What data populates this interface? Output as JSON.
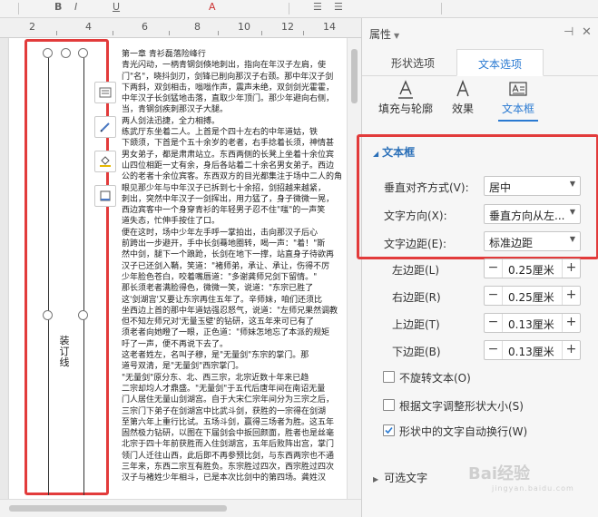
{
  "ruler": {
    "numbers": [
      "2",
      "4",
      "6",
      "8",
      "10",
      "12",
      "14"
    ]
  },
  "document": {
    "gutter_label": "装订线",
    "lines": [
      "第一章  青衫磊落险峰行",
      "  青光闪动，一柄青钢剑倏地刺出，指向在年汉子左肩，使",
      "门\"名\"，晓抖剑刃，剑锋已削向那汉子右颈。那中年汉子剑",
      "下两斜，双剑相击，嗡嗡作声，震声未绝，双剑剑光霍霍，",
      "中年汉子长剑猛地击落，直取少年顶门。那少年避向右侧，",
      "当，青钢剑疾刺那汉子大腿。",
      "  两人剑法迅捷，全力相搏。",
      "  练武厅东坐着二人。上首是个四十左右的中年道姑，铁",
      "下颌须，下首是个五十余岁的老者，右手捻着长须，神情甚",
      "男女弟子，都是肃肃站立。东西两侧的长凳上坐着十余位宾",
      "山四位相距一丈有余，身后各站着二十余名男女弟子。西边",
      "公的老者十余位宾客。东西双方的目光都集注于场中二人的角",
      "  眼见那少年与中年汉子已拆到七十余招，剑招越来越紧，",
      "刺出，突然中年汉子一剑挥出，用力猛了，身子微微一晃，",
      "西边宾客中一个身穿青衫的年轻男子忍不住\"嗤\"的一声笑",
      "道失态，忙伸手按住了口。",
      "  便在这时，场中少年左手呼一掌拍出，击向那汉子后心",
      "前跨出一步避开，手中长剑蓦地圈转，喝一声：\"着！\"斯",
      "然中剑，腿下一个踉跄，长剑在地下一撑，站直身子待欲再",
      "汉子已还剑入鞘，笑道：\"褚师弟，承让、承让，伤得不厉",
      "少年脸色苍白，咬着嘴唇道：\"多谢龚师兄剑下留情。\"",
      "  那长须老者满脸得色，微微一笑，说道：\"东宗已胜了",
      "这'剑湖宫'又要让东宗再住五年了。辛师妹，咱们还须比",
      "坐西边上首的那中年道姑强忍怒气，说道：\"左师兄果然调教",
      "但不知左师兄对'无量玉壁'的钻研，这五年来可已有了",
      "须老者向她瞪了一眼，正色道：\"师妹怎地忘了本派的规矩",
      "吁了一声，便不再说下去了。",
      "  这老者姓左，名叫子穆，是\"无量剑\"东宗的掌门。那",
      "道号双清，是\"无量剑\"西宗掌门。",
      "  \"无量剑\"原分东、北、西三宗，北宗近数十年来已趋",
      "二宗却均人才鼎盛。\"无量剑\"于五代后唐年间在南诏无量",
      "门人居住无量山剑湖宫。自于大宋仁宗年间分为三宗之后，",
      "三宗门下弟子在剑湖宫中比武斗剑，获胜的一宗得在剑湖",
      "至第六年上重行比试。五场斗剑，赢得三场者为胜。这五年",
      "固然极力钻研，以图在下届剑会中扳回颜面，胜者也是丝毫",
      "北宗于四十年前获胜而入住剑湖宫，五年后败阵出宫，掌门",
      "领门人迁往山西，此后即不再参预比剑，与东西两宗也不通",
      "三年来，东西二宗互有胜负。东宗胜过四次，西宗胜过四次",
      "汉子与褚姓少年相斗，已是本次比剑中的第四场。龚姓汉"
    ]
  },
  "panel": {
    "title": "属性",
    "tabs": [
      "形状选项",
      "文本选项"
    ],
    "subtabs": [
      "填充与轮廓",
      "效果",
      "文本框"
    ],
    "section_title": "文本框",
    "rows": [
      {
        "label": "垂直对齐方式(V):",
        "value": "居中"
      },
      {
        "label": "文字方向(X):",
        "value": "垂直方向从左..."
      },
      {
        "label": "文字边距(E):",
        "value": "标准边距"
      }
    ],
    "margins": [
      {
        "label": "左边距(L)",
        "value": "0.25厘米"
      },
      {
        "label": "右边距(R)",
        "value": "0.25厘米"
      },
      {
        "label": "上边距(T)",
        "value": "0.13厘米"
      },
      {
        "label": "下边距(B)",
        "value": "0.13厘米"
      }
    ],
    "checkboxes": [
      {
        "label": "不旋转文本(O)",
        "checked": false
      },
      {
        "label": "根据文字调整形状大小(S)",
        "checked": false
      },
      {
        "label": "形状中的文字自动换行(W)",
        "checked": true
      }
    ],
    "optional_text": "可选文字",
    "accent_color": "#2a7ad2",
    "highlight_color": "#e23b3b"
  },
  "watermark": {
    "text": "Bai经验",
    "sub": "jingyan.baidu.com"
  }
}
